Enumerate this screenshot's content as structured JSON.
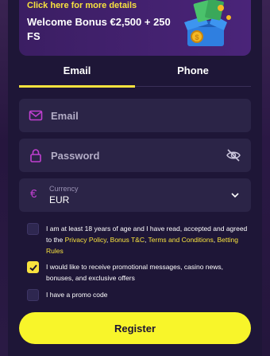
{
  "banner": {
    "link_text": "Click here for more details",
    "title": "Welcome Bonus €2,500 + 250 FS"
  },
  "tabs": [
    {
      "label": "Email",
      "active": true
    },
    {
      "label": "Phone",
      "active": false
    }
  ],
  "form": {
    "email_placeholder": "Email",
    "password_placeholder": "Password",
    "currency_label": "Currency",
    "currency_value": "EUR",
    "currency_symbol": "€"
  },
  "consents": {
    "terms": {
      "checked": false,
      "text_pre": "I am at least 18 years of age and I have read, accepted and agreed to the ",
      "link1": "Privacy Policy",
      "sep1": ", ",
      "link2": "Bonus T&C",
      "sep2": ", ",
      "link3": "Terms and Conditions",
      "sep3": ", ",
      "link4": "Betting Rules"
    },
    "promo_messages": {
      "checked": true,
      "text": "I would like to receive promotional messages, casino news, bonuses, and exclusive offers"
    },
    "promo_code": {
      "checked": false,
      "text": "I have a promo code"
    }
  },
  "register_label": "Register",
  "colors": {
    "accent_yellow": "#f8e23e",
    "button_yellow": "#f8f52a",
    "background": "#1e1637",
    "field_bg": "#2b2447",
    "icon_magenta": "#c03fd0"
  },
  "icons": {
    "email": "mail-icon",
    "password": "lock-icon",
    "toggle_visibility": "eye-off-icon",
    "currency": "euro-icon",
    "dropdown": "chevron-down-icon",
    "banner_art": "gift-box-icon"
  }
}
